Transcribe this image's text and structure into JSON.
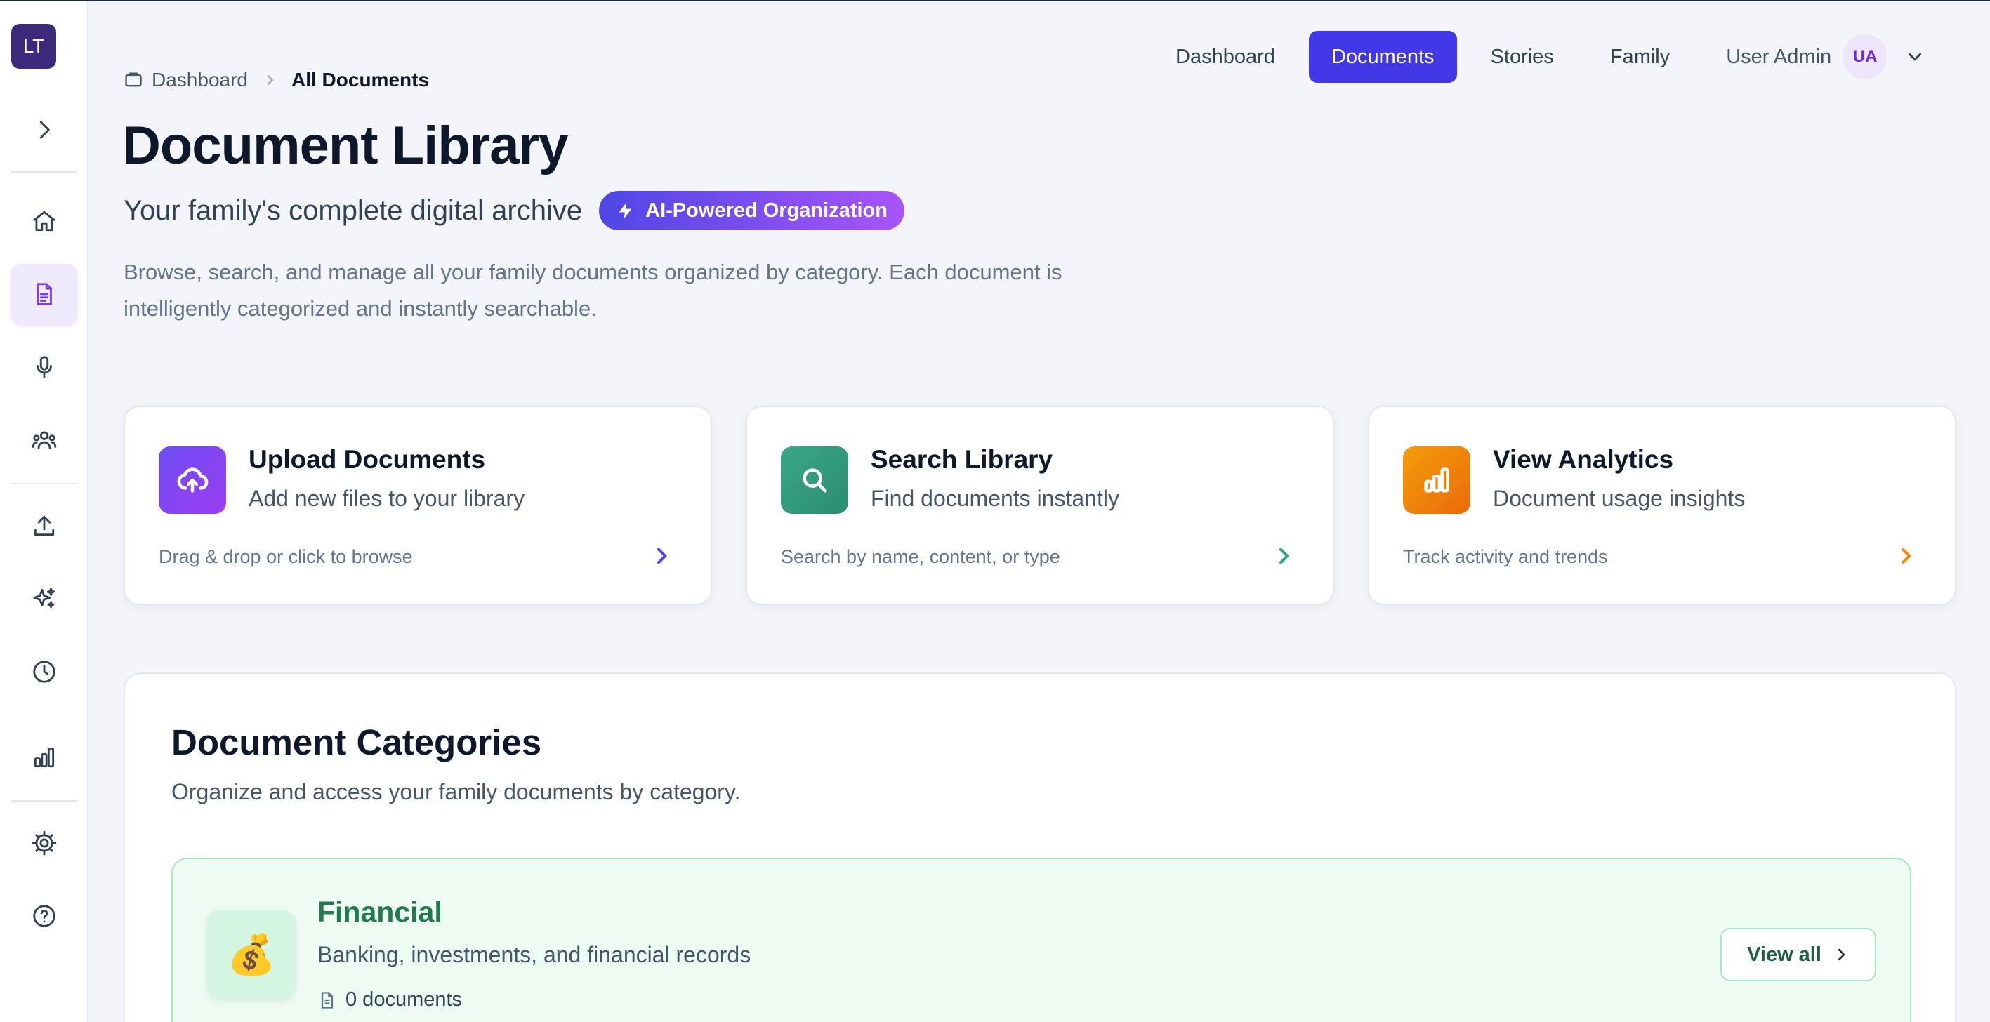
{
  "sidebar": {
    "logo": "LT",
    "items": [
      {
        "icon": "home-icon"
      },
      {
        "icon": "document-icon",
        "active": true
      },
      {
        "icon": "microphone-icon"
      },
      {
        "icon": "people-icon"
      },
      {
        "icon": "upload-icon"
      },
      {
        "icon": "sparkles-icon"
      },
      {
        "icon": "clock-icon"
      },
      {
        "icon": "bar-chart-icon"
      },
      {
        "icon": "settings-icon"
      },
      {
        "icon": "help-icon"
      }
    ]
  },
  "nav": {
    "items": [
      "Dashboard",
      "Documents",
      "Stories",
      "Family"
    ],
    "active": "Documents",
    "user_name": "User Admin",
    "user_initials": "UA"
  },
  "breadcrumb": {
    "root": "Dashboard",
    "current": "All Documents"
  },
  "header": {
    "title": "Document Library",
    "subtitle": "Your family's complete digital archive",
    "badge": "AI-Powered Organization",
    "description_line1": "Browse, search, and manage all your family documents organized by category. Each document is",
    "description_line2": "intelligently categorized and instantly searchable."
  },
  "actions": [
    {
      "title": "Upload Documents",
      "subtitle": "Add new files to your library",
      "hint": "Drag & drop or click to browse",
      "icon": "cloud-upload-icon",
      "color": "#7c3aed"
    },
    {
      "title": "Search Library",
      "subtitle": "Find documents instantly",
      "hint": "Search by name, content, or type",
      "icon": "search-icon",
      "color": "#2f9e7e"
    },
    {
      "title": "View Analytics",
      "subtitle": "Document usage insights",
      "hint": "Track activity and trends",
      "icon": "bar-chart-icon",
      "color": "#f08a0c"
    }
  ],
  "categories": {
    "title": "Document Categories",
    "subtitle": "Organize and access your family documents by category.",
    "items": [
      {
        "name": "Financial",
        "emoji": "💰",
        "description": "Banking, investments, and financial records",
        "count": "0 documents",
        "action": "View all",
        "color": "#217a4f"
      }
    ]
  }
}
